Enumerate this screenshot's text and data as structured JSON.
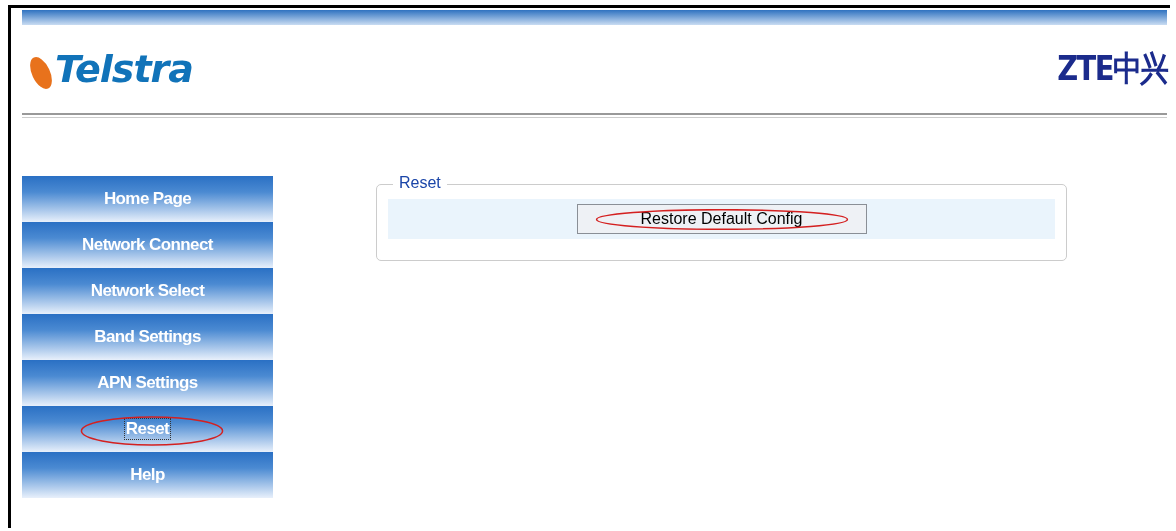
{
  "header": {
    "brand_logo": "Telstra",
    "maker_logo": "ZTE中兴"
  },
  "sidebar": {
    "items": [
      {
        "label": "Home Page",
        "selected": false,
        "circled": false
      },
      {
        "label": "Network Connect",
        "selected": false,
        "circled": false
      },
      {
        "label": "Network Select",
        "selected": false,
        "circled": false
      },
      {
        "label": "Band Settings",
        "selected": false,
        "circled": false
      },
      {
        "label": "APN Settings",
        "selected": false,
        "circled": false
      },
      {
        "label": "Reset",
        "selected": true,
        "circled": true
      },
      {
        "label": "Help",
        "selected": false,
        "circled": false
      }
    ]
  },
  "panel": {
    "legend": "Reset",
    "button": {
      "label": "Restore Default Config",
      "circled": true
    }
  }
}
